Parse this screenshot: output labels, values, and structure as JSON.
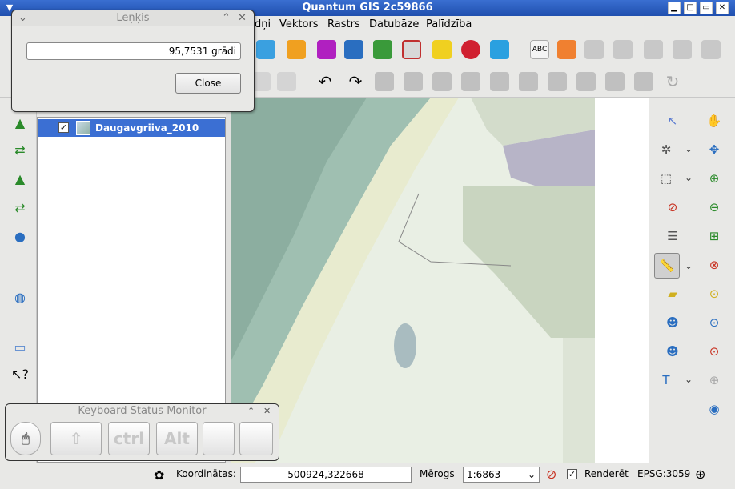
{
  "window": {
    "title": "Quantum GIS 2c59866"
  },
  "menu": {
    "items": [
      "dņi",
      "Vektors",
      "Rastrs",
      "Datubāze",
      "Palīdzība"
    ]
  },
  "layers": {
    "items": [
      {
        "name": "Daugavgriiva_2010",
        "checked": true
      }
    ]
  },
  "dialog": {
    "title": "Leņķis",
    "value": "95,7531 grādi",
    "close_label": "Close"
  },
  "keyboard_monitor": {
    "title": "Keyboard Status Monitor",
    "keys": [
      "ctrl",
      "Alt"
    ]
  },
  "statusbar": {
    "coordinates_label": "Koordinātas:",
    "coordinates_value": "500924,322668",
    "scale_label": "Mērogs",
    "scale_value": "1:6863",
    "render_label": "Renderēt",
    "render_checked": true,
    "crs": "EPSG:3059"
  },
  "icons": {
    "right_toolbar": [
      "identify-icon",
      "pan-icon",
      "settings-icon",
      "pan-to-selection-icon",
      "select-icon",
      "zoom-in-icon",
      "deselect-icon",
      "zoom-out-icon",
      "attribute-table-icon",
      "zoom-full-icon",
      "measure-icon",
      "zoom-to-layer-icon",
      "annotation-icon",
      "zoom-to-selection-icon",
      "html-annotation-icon",
      "zoom-last-icon",
      "home-annotation-icon",
      "zoom-next-icon",
      "text-annotation-icon",
      "refresh-icon",
      "gps-icon"
    ],
    "left_toolbar": [
      "add-raster-icon",
      "add-vector-icon",
      "add-postgis-icon",
      "add-wms-icon",
      "add-database-icon",
      "whats-this-icon"
    ]
  }
}
